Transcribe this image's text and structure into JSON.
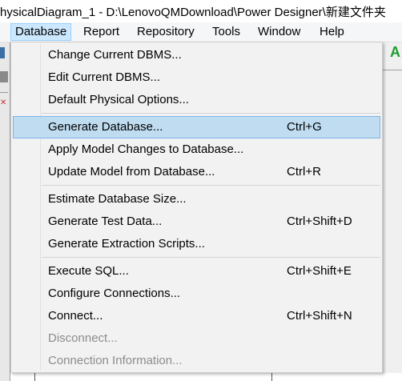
{
  "window": {
    "title": "hysicalDiagram_1 - D:\\LenovoQMDownload\\Power Designer\\新建文件夹"
  },
  "menubar": {
    "items": [
      "Database",
      "Report",
      "Repository",
      "Tools",
      "Window",
      "Help"
    ],
    "active": "Database"
  },
  "toolbar_right": {
    "glyph": "A"
  },
  "dropdown": {
    "groups": [
      [
        {
          "label": "Change Current DBMS...",
          "shortcut": "",
          "enabled": true
        },
        {
          "label": "Edit Current DBMS...",
          "shortcut": "",
          "enabled": true
        },
        {
          "label": "Default Physical Options...",
          "shortcut": "",
          "enabled": true
        }
      ],
      [
        {
          "label": "Generate Database...",
          "shortcut": "Ctrl+G",
          "enabled": true,
          "highlighted": true
        },
        {
          "label": "Apply Model Changes to Database...",
          "shortcut": "",
          "enabled": true
        },
        {
          "label": "Update Model from Database...",
          "shortcut": "Ctrl+R",
          "enabled": true
        }
      ],
      [
        {
          "label": "Estimate Database Size...",
          "shortcut": "",
          "enabled": true
        },
        {
          "label": "Generate Test Data...",
          "shortcut": "Ctrl+Shift+D",
          "enabled": true
        },
        {
          "label": "Generate Extraction Scripts...",
          "shortcut": "",
          "enabled": true
        }
      ],
      [
        {
          "label": "Execute SQL...",
          "shortcut": "Ctrl+Shift+E",
          "enabled": true
        },
        {
          "label": "Configure Connections...",
          "shortcut": "",
          "enabled": true
        },
        {
          "label": "Connect...",
          "shortcut": "Ctrl+Shift+N",
          "enabled": true
        },
        {
          "label": "Disconnect...",
          "shortcut": "",
          "enabled": false
        },
        {
          "label": "Connection Information...",
          "shortcut": "",
          "enabled": false
        }
      ]
    ]
  }
}
